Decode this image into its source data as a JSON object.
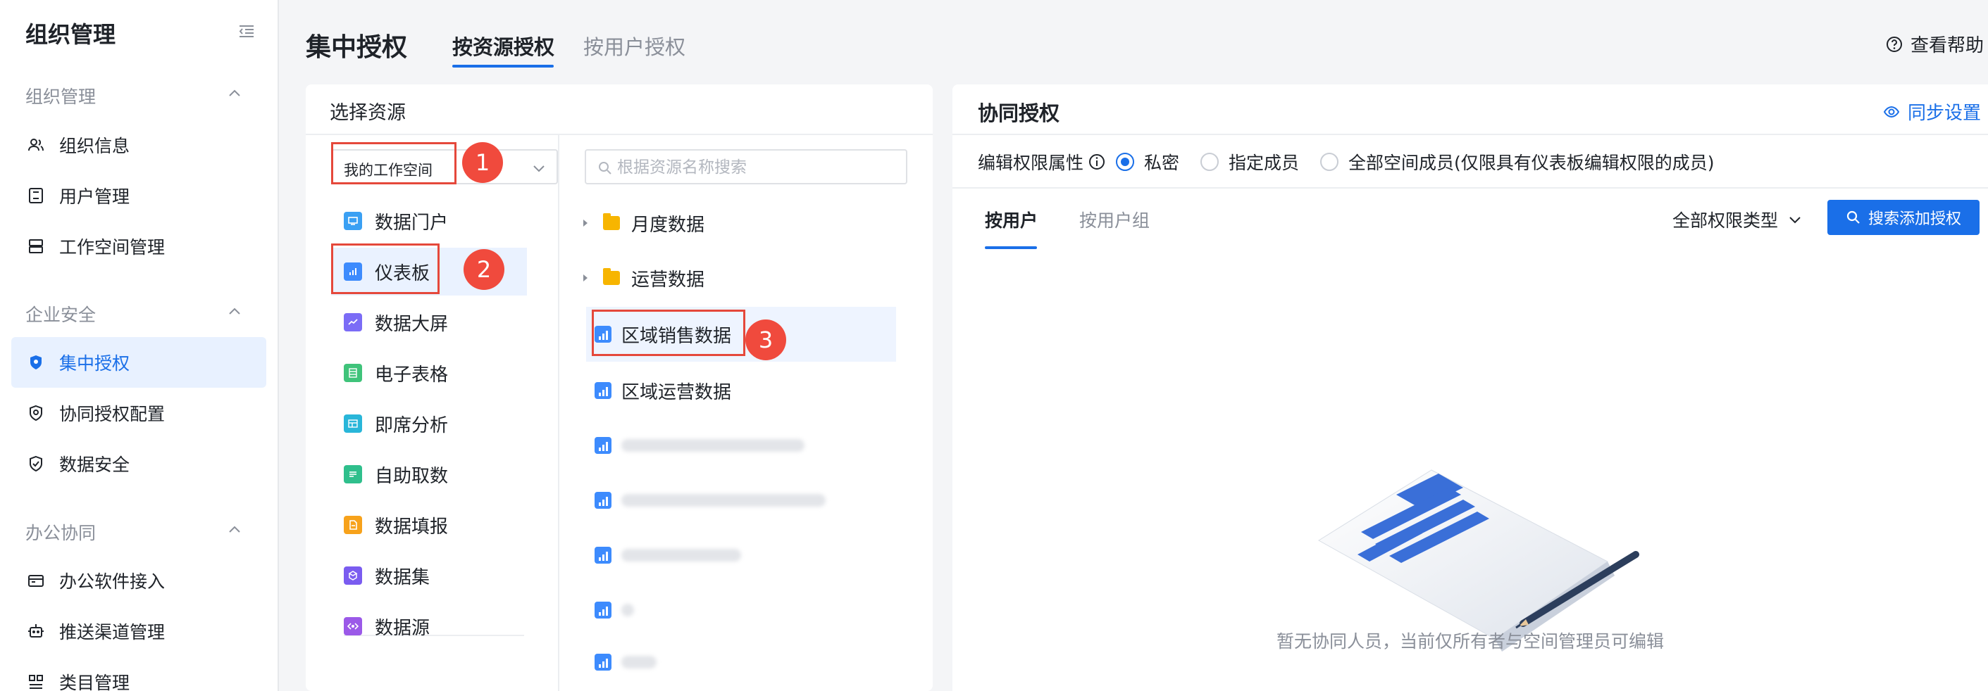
{
  "sidebar": {
    "title": "组织管理",
    "sections": [
      {
        "label": "组织管理",
        "items": [
          "组织信息",
          "用户管理",
          "工作空间管理"
        ]
      },
      {
        "label": "企业安全",
        "items": [
          "集中授权",
          "协同授权配置",
          "数据安全"
        ]
      },
      {
        "label": "办公协同",
        "items": [
          "办公软件接入",
          "推送渠道管理",
          "类目管理"
        ]
      }
    ],
    "active_item": "集中授权"
  },
  "header": {
    "title": "集中授权",
    "tabs": [
      "按资源授权",
      "按用户授权"
    ],
    "active_tab": "按资源授权",
    "help": "查看帮助"
  },
  "left_panel": {
    "title": "选择资源",
    "workspace_select": "我的工作空间",
    "resource_types": [
      "数据门户",
      "仪表板",
      "数据大屏",
      "电子表格",
      "即席分析",
      "自助取数",
      "数据填报",
      "数据集",
      "数据源"
    ],
    "active_type": "仪表板",
    "search_placeholder": "根据资源名称搜索",
    "tree": {
      "folders": [
        "月度数据",
        "运营数据"
      ],
      "items": [
        "区域销售数据",
        "区域运营数据"
      ],
      "selected": "区域销售数据"
    },
    "badges": [
      "1",
      "2",
      "3"
    ]
  },
  "right_panel": {
    "title": "协同授权",
    "sync_label": "同步设置",
    "perm_label": "编辑权限属性",
    "perm_options": [
      "私密",
      "指定成员",
      "全部空间成员(仅限具有仪表板编辑权限的成员)"
    ],
    "perm_selected": "私密",
    "sub_tabs": [
      "按用户",
      "按用户组"
    ],
    "active_sub_tab": "按用户",
    "filter_label": "全部权限类型",
    "add_button": "搜索添加授权",
    "empty_text": "暂无协同人员，当前仅所有者与空间管理员可编辑"
  },
  "colors": {
    "accent": "#1a6fe8",
    "highlight": "#e5483b",
    "badge": "#f04a3d"
  }
}
